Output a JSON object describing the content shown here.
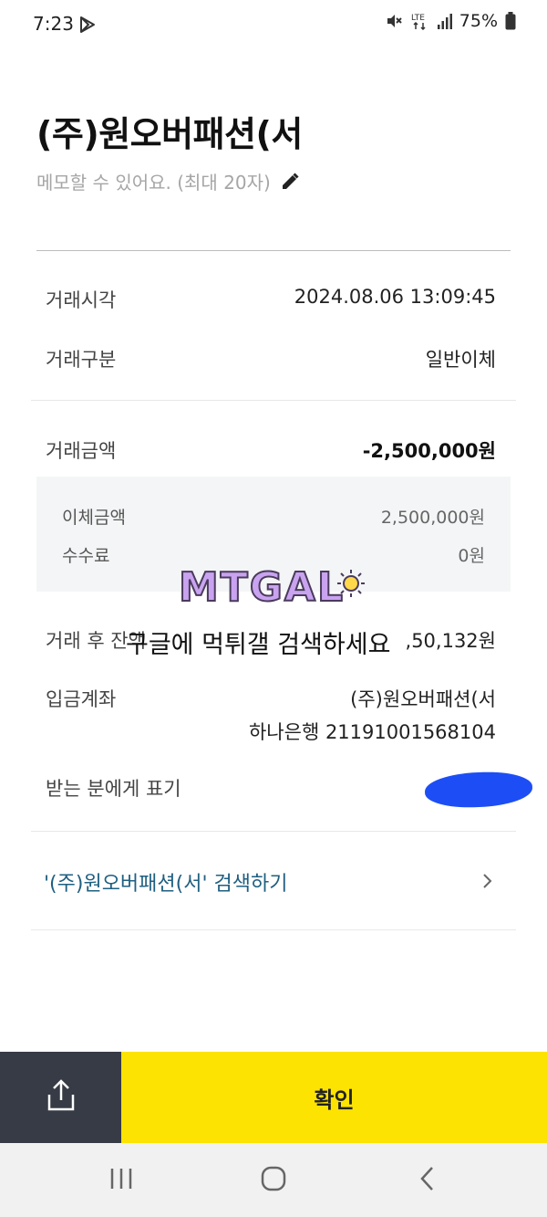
{
  "status_bar": {
    "time": "7:23",
    "battery": "75%",
    "icons": [
      "play-store-icon",
      "mute-icon",
      "lte-icon",
      "signal-icon",
      "battery-icon"
    ]
  },
  "header": {
    "title": "(주)원오버패션(서",
    "memo_placeholder": "메모할 수 있어요. (최대 20자)"
  },
  "details": {
    "time_label": "거래시각",
    "time_value": "2024.08.06 13:09:45",
    "type_label": "거래구분",
    "type_value": "일반이체",
    "amount_label": "거래금액",
    "amount_value": "-2,500,000원",
    "transfer_label": "이체금액",
    "transfer_value": "2,500,000원",
    "fee_label": "수수료",
    "fee_value": "0원",
    "balance_label": "거래 후 잔액",
    "balance_value": ",50,132원",
    "deposit_label": "입금계좌",
    "deposit_name": "(주)원오버패션(서",
    "deposit_account": "하나은행 21191001568104",
    "display_label": "받는 분에게 표기"
  },
  "watermark": {
    "logo": "MTGAL",
    "text": "구글에 먹튀갤 검색하세요"
  },
  "search_link": "'(주)원오버패션(서' 검색하기",
  "bottom": {
    "confirm_label": "확인"
  },
  "colors": {
    "accent_yellow": "#fde301",
    "share_dark": "#363b45",
    "link_blue": "#1f5f80"
  }
}
